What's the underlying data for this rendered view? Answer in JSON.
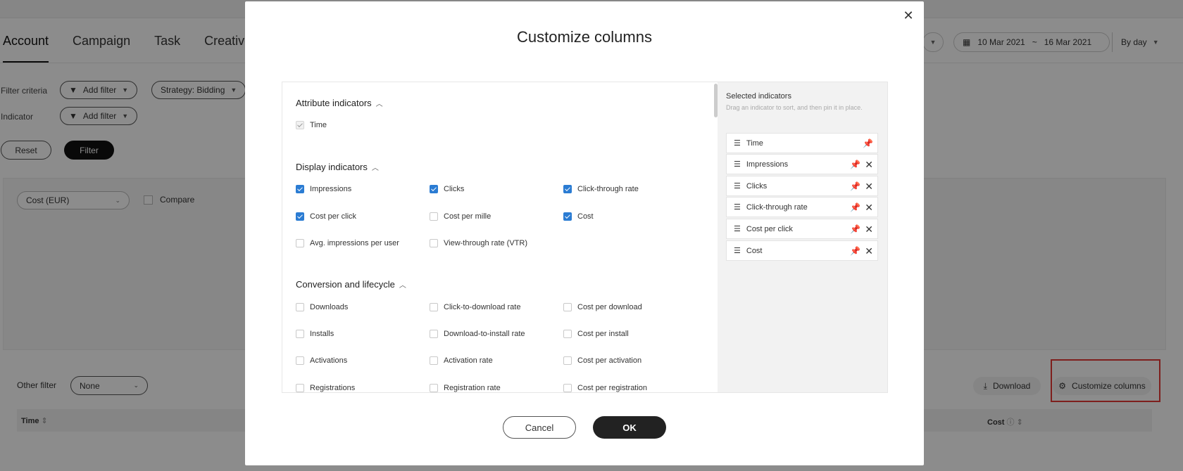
{
  "background": {
    "tabs": [
      "Account",
      "Campaign",
      "Task",
      "Creative"
    ],
    "filter_criteria_label": "Filter criteria",
    "indicator_label": "Indicator",
    "add_filter": "Add filter",
    "strategy": "Strategy: Bidding",
    "reset": "Reset",
    "filter": "Filter",
    "cost_select": "Cost (EUR)",
    "compare": "Compare",
    "date_start": "10 Mar 2021",
    "date_sep": "~",
    "date_end": "16 Mar 2021",
    "granularity": "By day",
    "other_filter_label": "Other filter",
    "other_filter_value": "None",
    "download": "Download",
    "customize_columns": "Customize columns",
    "col_time": "Time",
    "col_cost": "Cost"
  },
  "modal": {
    "title": "Customize columns",
    "sections": [
      {
        "title": "Attribute indicators",
        "items": [
          {
            "label": "Time",
            "state": "disabled"
          }
        ]
      },
      {
        "title": "Display indicators",
        "items": [
          {
            "label": "Impressions",
            "state": "checked"
          },
          {
            "label": "Clicks",
            "state": "checked"
          },
          {
            "label": "Click-through rate",
            "state": "checked"
          },
          {
            "label": "Cost per click",
            "state": "checked"
          },
          {
            "label": "Cost per mille",
            "state": "unchecked"
          },
          {
            "label": "Cost",
            "state": "checked"
          },
          {
            "label": "Avg. impressions per user",
            "state": "unchecked"
          },
          {
            "label": "View-through rate (VTR)",
            "state": "unchecked"
          }
        ]
      },
      {
        "title": "Conversion and lifecycle",
        "items": [
          {
            "label": "Downloads",
            "state": "unchecked"
          },
          {
            "label": "Click-to-download rate",
            "state": "unchecked"
          },
          {
            "label": "Cost per download",
            "state": "unchecked"
          },
          {
            "label": "Installs",
            "state": "unchecked"
          },
          {
            "label": "Download-to-install rate",
            "state": "unchecked"
          },
          {
            "label": "Cost per install",
            "state": "unchecked"
          },
          {
            "label": "Activations",
            "state": "unchecked"
          },
          {
            "label": "Activation rate",
            "state": "unchecked"
          },
          {
            "label": "Cost per activation",
            "state": "unchecked"
          },
          {
            "label": "Registrations",
            "state": "unchecked"
          },
          {
            "label": "Registration rate",
            "state": "unchecked"
          },
          {
            "label": "Cost per registration",
            "state": "unchecked"
          }
        ]
      }
    ],
    "selected_title": "Selected indicators",
    "selected_hint": "Drag an indicator to sort, and then pin it in place.",
    "selected": [
      {
        "label": "Time",
        "removable": false
      },
      {
        "label": "Impressions",
        "removable": true
      },
      {
        "label": "Clicks",
        "removable": true
      },
      {
        "label": "Click-through rate",
        "removable": true
      },
      {
        "label": "Cost per click",
        "removable": true
      },
      {
        "label": "Cost",
        "removable": true
      }
    ],
    "cancel": "Cancel",
    "ok": "OK"
  },
  "colors": {
    "checkbox_accent": "#2b7cd3",
    "highlight": "#e53935",
    "primary_button": "#222222"
  },
  "icons": {
    "close": "close-icon",
    "drag": "drag-handle-icon",
    "pin": "pin-icon",
    "remove": "remove-icon"
  }
}
